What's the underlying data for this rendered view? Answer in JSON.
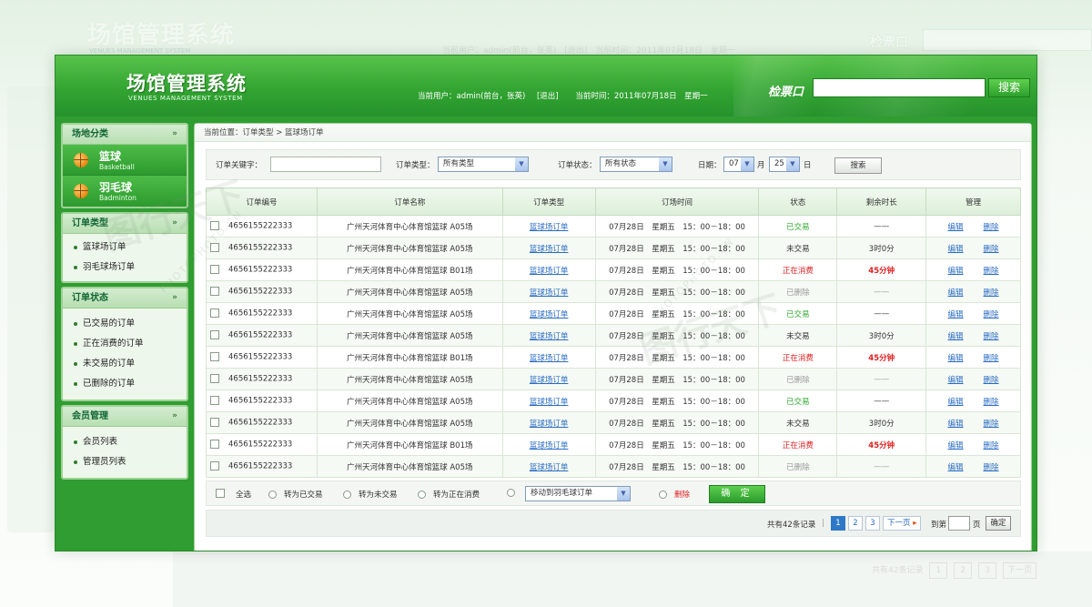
{
  "app": {
    "title": "场馆管理系统",
    "subtitle": "VENUES MANAGEMENT SYSTEM"
  },
  "header": {
    "current_user": "当前用户：admin(前台，张英)",
    "logout": "[退出]",
    "current_time": "当前时间：2011年07月18日　星期一",
    "ticket_label": "检票口",
    "search_button": "搜索"
  },
  "sidebar": {
    "venue_category": {
      "title": "场地分类",
      "items": [
        {
          "name": "篮球",
          "en": "Basketball"
        },
        {
          "name": "羽毛球",
          "en": "Badminton"
        }
      ]
    },
    "order_type": {
      "title": "订单类型",
      "items": [
        "篮球场订单",
        "羽毛球场订单"
      ]
    },
    "order_status": {
      "title": "订单状态",
      "items": [
        "已交易的订单",
        "正在消费的订单",
        "未交易的订单",
        "已删除的订单"
      ]
    },
    "member_mgmt": {
      "title": "会员管理",
      "items": [
        "会员列表",
        "管理员列表"
      ]
    }
  },
  "breadcrumb": "当前位置：订单类型 > 篮球场订单",
  "filter": {
    "keyword_label": "订单关键字：",
    "keyword_value": "",
    "type_label": "订单类型：",
    "type_value": "所有类型",
    "status_label": "订单状态：",
    "status_value": "所有状态",
    "date_label": "日期：",
    "month_value": "07",
    "month_unit": "月",
    "day_value": "25",
    "day_unit": "日",
    "search_button": "搜索"
  },
  "table": {
    "headers": [
      "订单编号",
      "订单名称",
      "订单类型",
      "订场时间",
      "状态",
      "剩余时长",
      "管理"
    ],
    "edit_label": "编辑",
    "delete_label": "删除",
    "rows": [
      {
        "id": "4656155222333",
        "name": "广州天河体育中心体育馆篮球 A05场",
        "type": "篮球场订单",
        "time": "07月28日　星期五　15：00－18：00",
        "status": "已交易",
        "status_kind": "green",
        "remaining": "——",
        "remaining_kind": "dash"
      },
      {
        "id": "4656155222333",
        "name": "广州天河体育中心体育馆篮球 A05场",
        "type": "篮球场订单",
        "time": "07月28日　星期五　15：00－18：00",
        "status": "未交易",
        "status_kind": "normal",
        "remaining": "3时0分",
        "remaining_kind": "normal"
      },
      {
        "id": "4656155222333",
        "name": "广州天河体育中心体育馆篮球 B01场",
        "type": "篮球场订单",
        "time": "07月28日　星期五　15：00－18：00",
        "status": "正在消费",
        "status_kind": "red",
        "remaining": "45分钟",
        "remaining_kind": "red"
      },
      {
        "id": "4656155222333",
        "name": "广州天河体育中心体育馆篮球 A05场",
        "type": "篮球场订单",
        "time": "07月28日　星期五　15：00－18：00",
        "status": "已删除",
        "status_kind": "gray",
        "remaining": "——",
        "remaining_kind": "gray"
      },
      {
        "id": "4656155222333",
        "name": "广州天河体育中心体育馆篮球 A05场",
        "type": "篮球场订单",
        "time": "07月28日　星期五　15：00－18：00",
        "status": "已交易",
        "status_kind": "green",
        "remaining": "——",
        "remaining_kind": "dash"
      },
      {
        "id": "4656155222333",
        "name": "广州天河体育中心体育馆篮球 A05场",
        "type": "篮球场订单",
        "time": "07月28日　星期五　15：00－18：00",
        "status": "未交易",
        "status_kind": "normal",
        "remaining": "3时0分",
        "remaining_kind": "normal"
      },
      {
        "id": "4656155222333",
        "name": "广州天河体育中心体育馆篮球 B01场",
        "type": "篮球场订单",
        "time": "07月28日　星期五　15：00－18：00",
        "status": "正在消费",
        "status_kind": "red",
        "remaining": "45分钟",
        "remaining_kind": "red"
      },
      {
        "id": "4656155222333",
        "name": "广州天河体育中心体育馆篮球 A05场",
        "type": "篮球场订单",
        "time": "07月28日　星期五　15：00－18：00",
        "status": "已删除",
        "status_kind": "gray",
        "remaining": "——",
        "remaining_kind": "gray"
      },
      {
        "id": "4656155222333",
        "name": "广州天河体育中心体育馆篮球 A05场",
        "type": "篮球场订单",
        "time": "07月28日　星期五　15：00－18：00",
        "status": "已交易",
        "status_kind": "green",
        "remaining": "——",
        "remaining_kind": "dash"
      },
      {
        "id": "4656155222333",
        "name": "广州天河体育中心体育馆篮球 A05场",
        "type": "篮球场订单",
        "time": "07月28日　星期五　15：00－18：00",
        "status": "未交易",
        "status_kind": "normal",
        "remaining": "3时0分",
        "remaining_kind": "normal"
      },
      {
        "id": "4656155222333",
        "name": "广州天河体育中心体育馆篮球 B01场",
        "type": "篮球场订单",
        "time": "07月28日　星期五　15：00－18：00",
        "status": "正在消费",
        "status_kind": "red",
        "remaining": "45分钟",
        "remaining_kind": "red"
      },
      {
        "id": "4656155222333",
        "name": "广州天河体育中心体育馆篮球 A05场",
        "type": "篮球场订单",
        "time": "07月28日　星期五　15：00－18：00",
        "status": "已删除",
        "status_kind": "gray",
        "remaining": "——",
        "remaining_kind": "gray"
      }
    ]
  },
  "actions": {
    "select_all": "全选",
    "to_traded": "转为已交易",
    "to_untraded": "转为未交易",
    "to_consuming": "转为正在消费",
    "move_to": "移动到羽毛球订单",
    "delete": "删除",
    "confirm": "确 定"
  },
  "pager": {
    "total": "共有42条记录",
    "pages": [
      "1",
      "2",
      "3"
    ],
    "next": "下一页",
    "goto_label": "到第",
    "goto_unit": "页",
    "goto_button": "确定"
  },
  "background": {
    "ghost_user": "当前用户：admin(前台，张英)　[退出]　当前时间：2011年07月18日　星期一",
    "ghost_pager_total": "共有42条记录",
    "ghost_pager_next": "下一页"
  },
  "watermark": {
    "text": "图行天下",
    "url": "PHOTOPHOTO.CN"
  },
  "colors": {
    "brand_green": "#2f9d31",
    "link_blue": "#2a6cc4",
    "status_red": "#e02020",
    "status_green": "#2da82d"
  }
}
